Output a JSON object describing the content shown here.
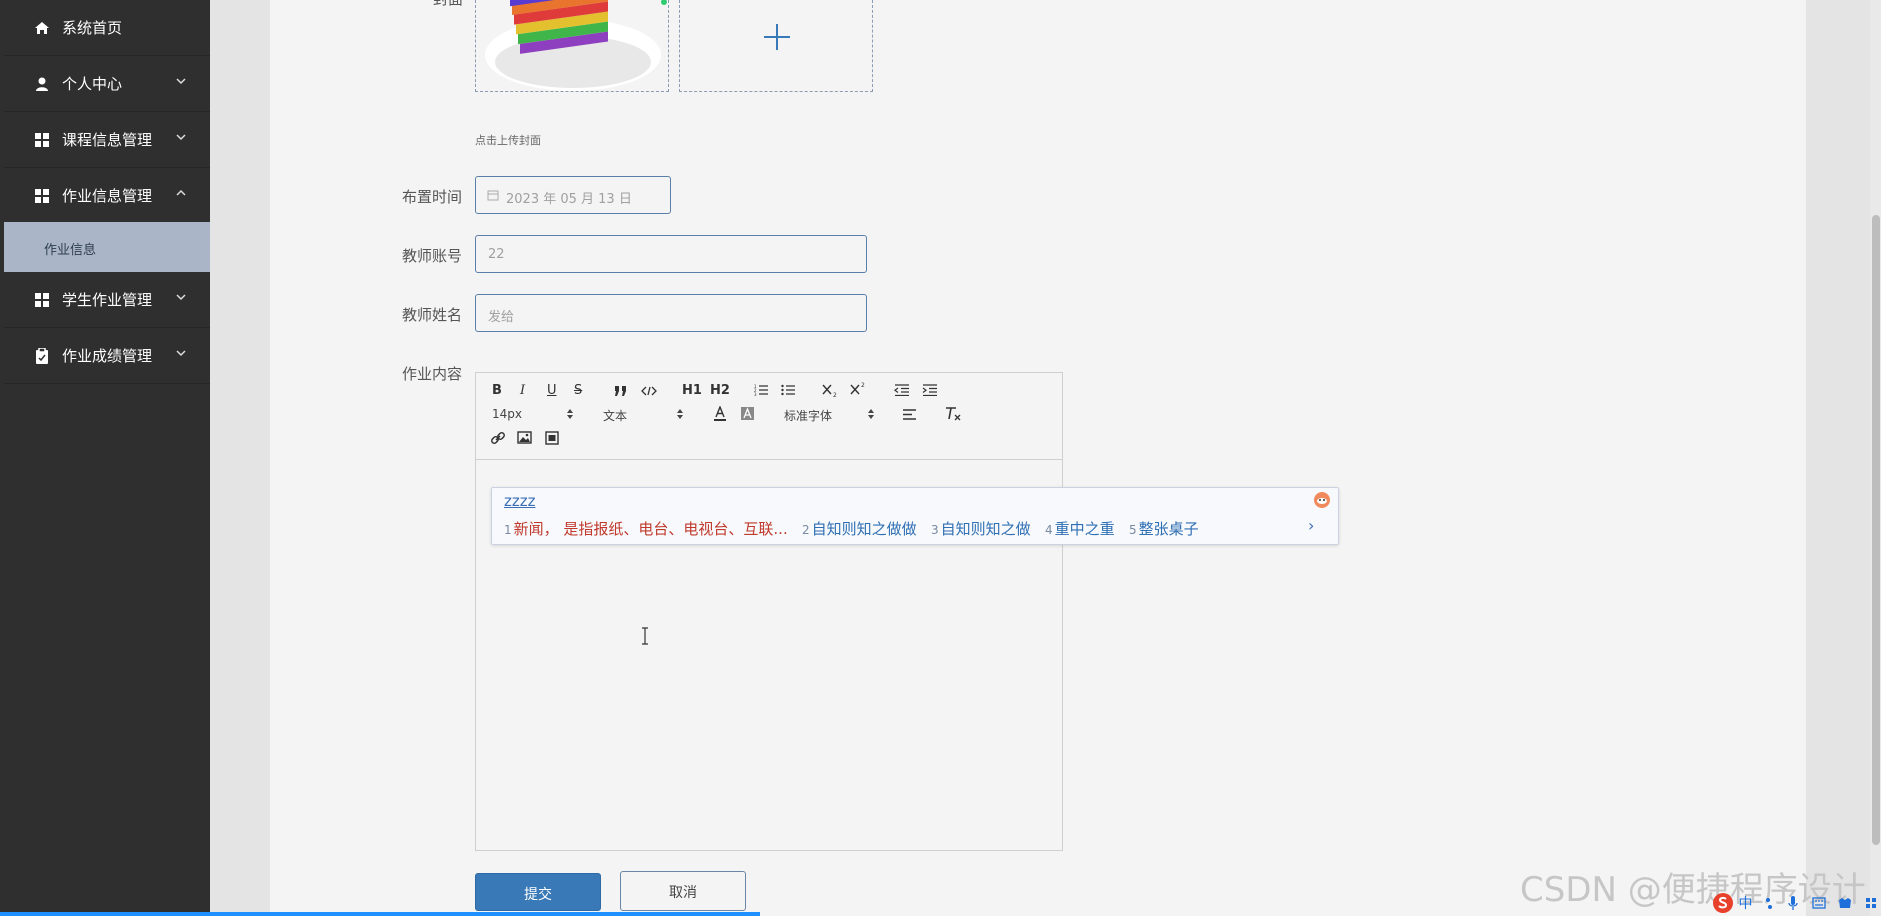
{
  "sidebar": {
    "items": [
      {
        "label": "系统首页",
        "icon": "home-icon"
      },
      {
        "label": "个人中心",
        "icon": "user-icon"
      },
      {
        "label": "课程信息管理",
        "icon": "grid-icon"
      },
      {
        "label": "作业信息管理",
        "icon": "grid-icon"
      },
      {
        "label": "学生作业管理",
        "icon": "grid-icon"
      },
      {
        "label": "作业成绩管理",
        "icon": "clipboard-icon"
      }
    ],
    "sub_item": "作业信息"
  },
  "form": {
    "cover_label": "封面",
    "cover_hint": "点击上传封面",
    "date_label": "布置时间",
    "date_value": "2023 年 05 月 13 日",
    "teacher_account_label": "教师账号",
    "teacher_account_value": "22",
    "teacher_name_label": "教师姓名",
    "teacher_name_value": "发给",
    "content_label": "作业内容"
  },
  "editor": {
    "font_size": "14px",
    "format": "文本",
    "font_family": "标准字体",
    "tb_h1": "H1",
    "tb_h2": "H2",
    "tb_bold": "B",
    "tb_italic": "I",
    "tb_underline": "U",
    "tb_strike": "S"
  },
  "ime": {
    "composition": "zzzz",
    "candidates": [
      {
        "num": "1",
        "text": "新闻， 是指报纸、电台、电视台、互联..."
      },
      {
        "num": "2",
        "text": "自知则知之做做"
      },
      {
        "num": "3",
        "text": "自知则知之做"
      },
      {
        "num": "4",
        "text": "重中之重"
      },
      {
        "num": "5",
        "text": "整张桌子"
      }
    ],
    "next": "›"
  },
  "buttons": {
    "submit": "提交",
    "cancel": "取消"
  },
  "watermark": "CSDN @便捷程序设计",
  "tray": "中"
}
